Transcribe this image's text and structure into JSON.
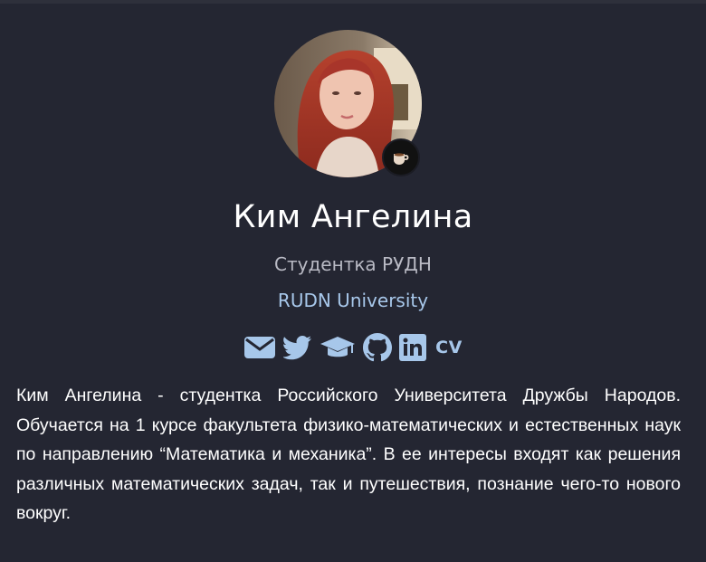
{
  "profile": {
    "name": "Ким Ангелина",
    "role": "Студентка РУДН",
    "organization": "RUDN University",
    "avatar_alt": "Profile photo",
    "status_icon": "coffee-cup-icon"
  },
  "social": {
    "links": [
      {
        "icon": "envelope-icon"
      },
      {
        "icon": "twitter-icon"
      },
      {
        "icon": "graduation-cap-icon"
      },
      {
        "icon": "github-icon"
      },
      {
        "icon": "linkedin-icon"
      }
    ],
    "cv_label": "CV"
  },
  "bio": {
    "text": "Ким Ангелина - студентка Российского Университета Дружбы Народов. Обучается на 1 курсе факультета физико-математических и естественных наук по направлению “Математика и механика”. В ее интересы входят как решения различных математических задач, так и путешествия, познание чего-то нового вокруг."
  },
  "colors": {
    "background": "#242632",
    "text": "#ffffff",
    "muted": "#b9bac4",
    "accent": "#a7c7ea"
  }
}
